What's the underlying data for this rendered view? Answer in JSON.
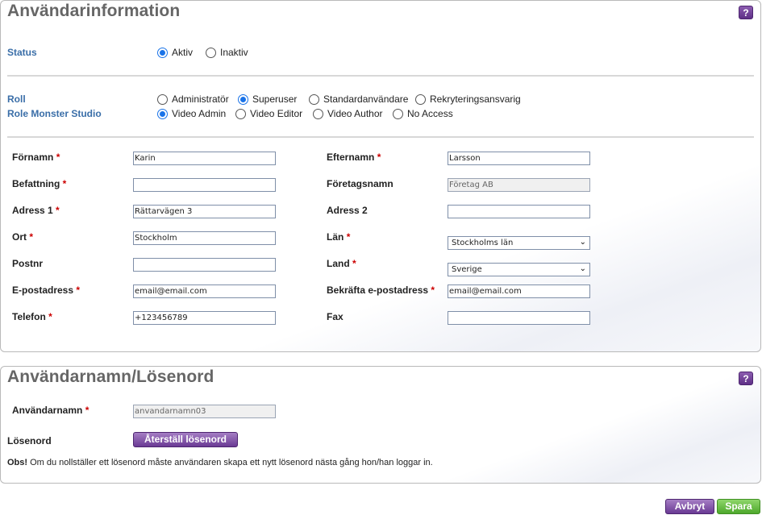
{
  "user_info": {
    "title": "Användarinformation",
    "help_label": "?",
    "status": {
      "label": "Status",
      "options": [
        {
          "label": "Aktiv",
          "selected": true
        },
        {
          "label": "Inaktiv",
          "selected": false
        }
      ]
    },
    "role": {
      "label": "Roll",
      "options": [
        {
          "label": "Administratör",
          "selected": false
        },
        {
          "label": "Superuser",
          "selected": true
        },
        {
          "label": "Standardanvändare",
          "selected": false
        },
        {
          "label": "Rekryteringsansvarig",
          "selected": false
        }
      ]
    },
    "role_studio": {
      "label": "Role Monster Studio",
      "options": [
        {
          "label": "Video Admin",
          "selected": true
        },
        {
          "label": "Video Editor",
          "selected": false
        },
        {
          "label": "Video Author",
          "selected": false
        },
        {
          "label": "No Access",
          "selected": false
        }
      ]
    },
    "required_mark": "*",
    "fields": {
      "firstname": {
        "label": "Förnamn",
        "value": "Karin"
      },
      "lastname": {
        "label": "Efternamn",
        "value": "Larsson"
      },
      "jobtitle": {
        "label": "Befattning",
        "value": ""
      },
      "company": {
        "label": "Företagsnamn",
        "value": "Företag AB"
      },
      "address1": {
        "label": "Adress 1",
        "value": "Rättarvägen 3"
      },
      "address2": {
        "label": "Adress 2",
        "value": ""
      },
      "city": {
        "label": "Ort",
        "value": "Stockholm"
      },
      "county": {
        "label": "Län",
        "value": "Stockholms län"
      },
      "zip": {
        "label": "Postnr",
        "value": ""
      },
      "country": {
        "label": "Land",
        "value": "Sverige"
      },
      "email": {
        "label": "E-postadress",
        "value": "email@email.com"
      },
      "email_confirm": {
        "label": "Bekräfta e-postadress",
        "value": "email@email.com"
      },
      "phone": {
        "label": "Telefon",
        "value": "+123456789"
      },
      "fax": {
        "label": "Fax",
        "value": ""
      }
    }
  },
  "login": {
    "title": "Användarnamn/Lösenord",
    "help_label": "?",
    "username_label": "Användarnamn",
    "username_value": "anvandarnamn03",
    "password_label": "Lösenord",
    "reset_button": "Återställ lösenord",
    "note_bold": "Obs!",
    "note_text": " Om du nollställer ett lösenord måste användaren skapa ett nytt lösenord nästa gång hon/han loggar in."
  },
  "actions": {
    "cancel": "Avbryt",
    "save": "Spara"
  },
  "colors": {
    "accent_purple": "#6a3a94",
    "accent_green": "#4ea82c",
    "section_label": "#3a6ea8",
    "required": "#cc0000",
    "radio_selected": "#1a73e8"
  }
}
